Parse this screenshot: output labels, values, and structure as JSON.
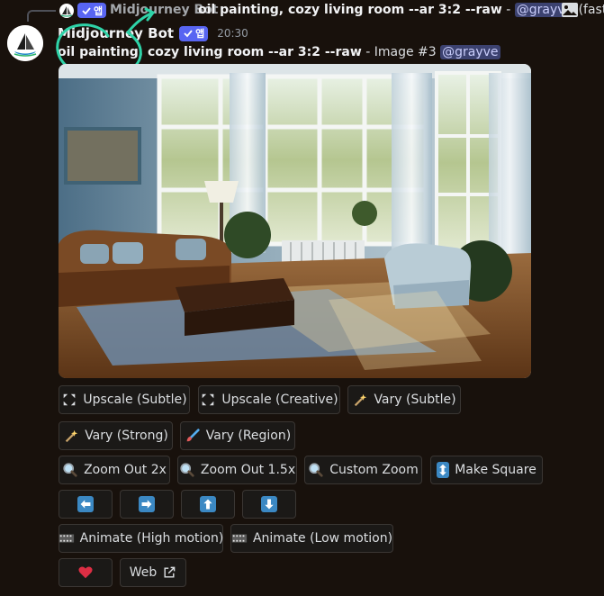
{
  "reply": {
    "author": "Midjourney Bot",
    "app_tag": "앱",
    "prompt": "oil painting, cozy living room --ar 3:2 --raw",
    "suffix": " - ",
    "mention": "@grayve",
    "trailing": " (fast, ste..."
  },
  "message": {
    "author": "Midjourney Bot",
    "app_tag": "앱",
    "timestamp": "20:30",
    "prompt": "oil painting, cozy living room --ar 3:2 --raw",
    "image_label": " - Image #3 ",
    "mention": "@grayve"
  },
  "buttons": {
    "upscale_subtle": "Upscale (Subtle)",
    "upscale_creative": "Upscale (Creative)",
    "vary_subtle": "Vary (Subtle)",
    "vary_strong": "Vary (Strong)",
    "vary_region": "Vary (Region)",
    "zoom_out_2x": "Zoom Out 2x",
    "zoom_out_15x": "Zoom Out 1.5x",
    "custom_zoom": "Custom Zoom",
    "make_square": "Make Square",
    "animate_high": "Animate (High motion)",
    "animate_low": "Animate (Low motion)",
    "web": "Web"
  },
  "colors": {
    "background": "#18110c",
    "app_badge": "#5865f2",
    "mention_bg": "#3c4270",
    "arrow_blue": "#3b88c3",
    "heart": "#dd2e44",
    "scribble": "#2ed3a8"
  }
}
